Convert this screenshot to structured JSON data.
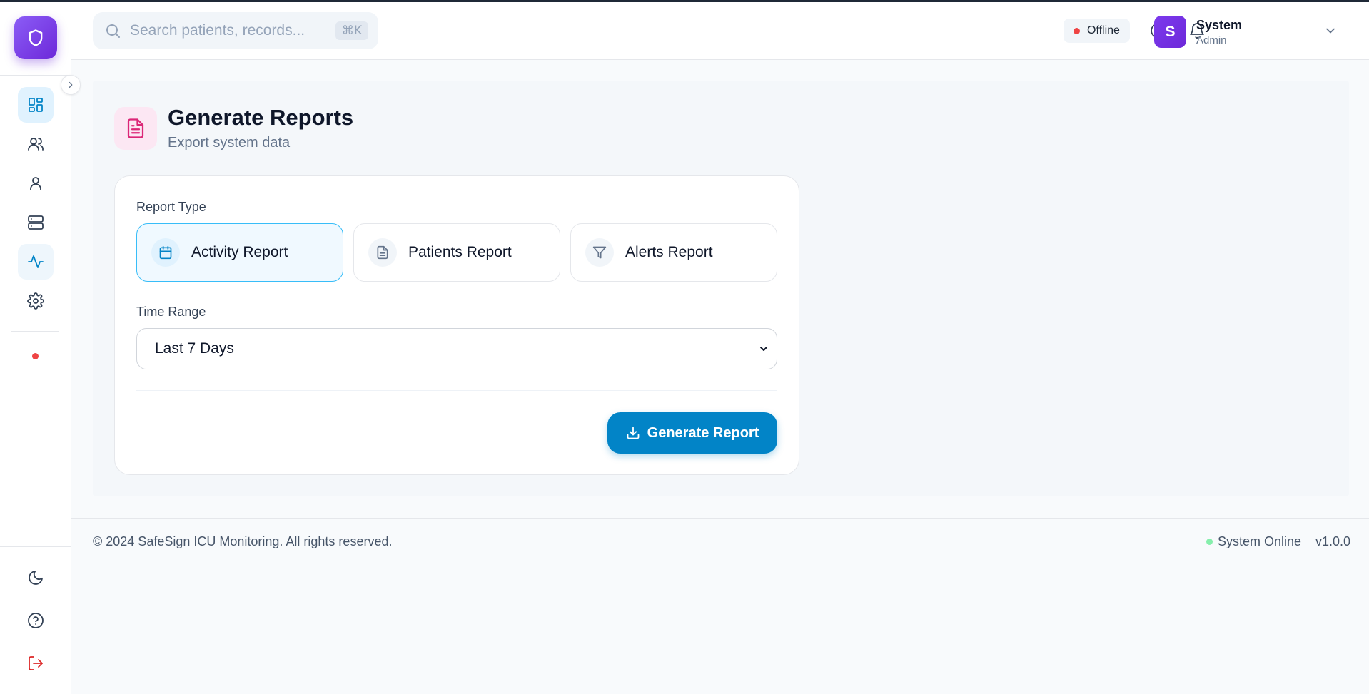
{
  "header": {
    "search_placeholder": "Search patients, records...",
    "search_shortcut": "⌘K",
    "connection_status": "Offline",
    "user": {
      "initial": "S",
      "name": "System",
      "role": "Admin"
    }
  },
  "sidebar": {
    "items": [
      {
        "name": "dashboard",
        "icon": "layout-grid-icon",
        "active": true
      },
      {
        "name": "users",
        "icon": "users-icon",
        "active": false
      },
      {
        "name": "profile",
        "icon": "user-icon",
        "active": false
      },
      {
        "name": "servers",
        "icon": "server-icon",
        "active": false
      },
      {
        "name": "activity",
        "icon": "activity-icon",
        "active": true
      },
      {
        "name": "settings",
        "icon": "gear-icon",
        "active": false
      }
    ],
    "bottom_items": [
      {
        "name": "theme",
        "icon": "moon-icon"
      },
      {
        "name": "help",
        "icon": "help-circle-icon"
      },
      {
        "name": "logout",
        "icon": "logout-icon"
      }
    ]
  },
  "page": {
    "title": "Generate Reports",
    "subtitle": "Export system data"
  },
  "form": {
    "report_type_label": "Report Type",
    "report_types": [
      {
        "label": "Activity Report",
        "icon": "calendar-icon",
        "selected": true
      },
      {
        "label": "Patients Report",
        "icon": "file-text-icon",
        "selected": false
      },
      {
        "label": "Alerts Report",
        "icon": "filter-icon",
        "selected": false
      }
    ],
    "time_range_label": "Time Range",
    "time_range_value": "Last 7 Days",
    "generate_label": "Generate Report"
  },
  "footer": {
    "copyright": "© 2024 SafeSign ICU Monitoring. All rights reserved.",
    "status": "System Online",
    "version": "v1.0.0"
  },
  "colors": {
    "brand": "#7c3aed",
    "primary": "#0284c7",
    "offline": "#ef4444",
    "online": "#86efac",
    "report_icon": "#db2777"
  }
}
